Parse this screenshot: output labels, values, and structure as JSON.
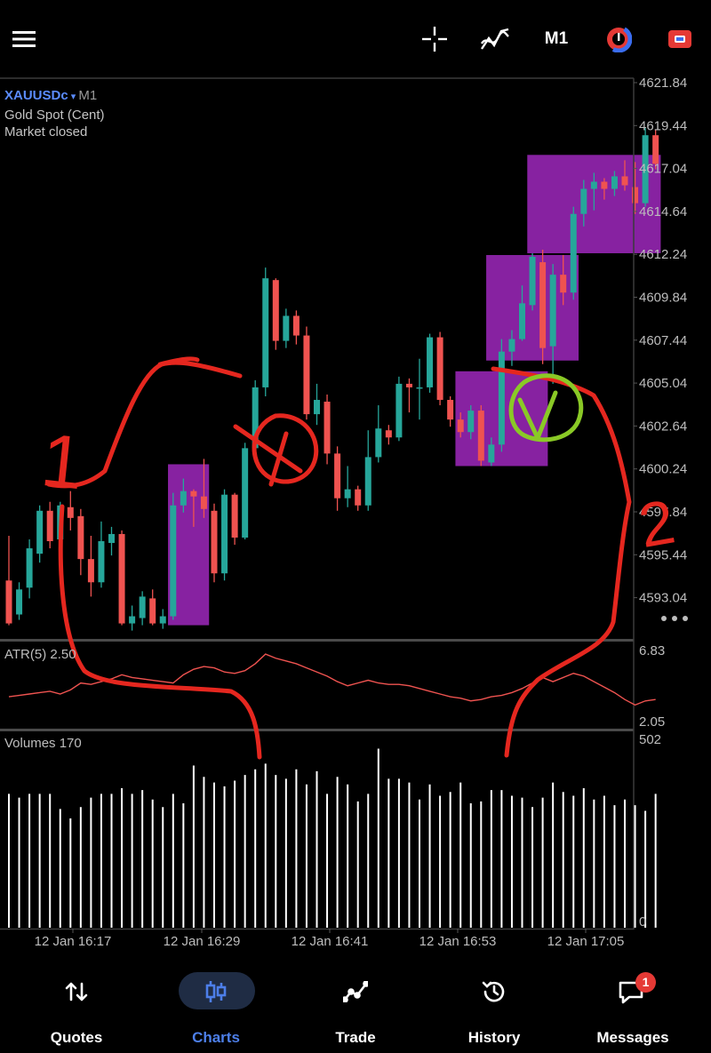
{
  "toolbar": {
    "menu_icon": "hamburger-menu-icon",
    "crosshair_icon": "crosshair-icon",
    "indicators_icon": "indicators-icon",
    "timeframe": "M1",
    "chart_type_icon": "chart-type-icon",
    "trade_icon": "trade-toggle-icon"
  },
  "chart_info": {
    "symbol": "XAUUSDc",
    "timeframe": "M1",
    "description": "Gold Spot (Cent)",
    "status": "Market closed"
  },
  "price_axis": [
    "4621.84",
    "4619.44",
    "4617.04",
    "4614.64",
    "4612.24",
    "4609.84",
    "4607.44",
    "4605.04",
    "4602.64",
    "4600.24",
    "4597.84",
    "4595.44",
    "4593.04"
  ],
  "atr": {
    "label": "ATR(5) 2.50",
    "axis_max": "6.83",
    "axis_min": "2.05"
  },
  "volumes": {
    "label": "Volumes 170",
    "axis_max": "502",
    "axis_min": "0"
  },
  "time_axis": [
    "12 Jan 16:17",
    "12 Jan 16:29",
    "12 Jan 16:41",
    "12 Jan 16:53",
    "12 Jan 17:05"
  ],
  "annotations": {
    "one": "1",
    "two": "2"
  },
  "colors": {
    "bull": "#26a69a",
    "bear": "#ef5350",
    "zone": "#8e24aa",
    "ink_red": "#e5271f",
    "ink_green": "#8ac926",
    "accent": "#4d7fe9"
  },
  "nav": {
    "items": [
      {
        "label": "Quotes",
        "icon": "quotes-arrows-icon"
      },
      {
        "label": "Charts",
        "icon": "charts-candles-icon"
      },
      {
        "label": "Trade",
        "icon": "trade-line-icon"
      },
      {
        "label": "History",
        "icon": "history-clock-icon"
      },
      {
        "label": "Messages",
        "icon": "messages-icon"
      }
    ],
    "messages_badge": "1"
  },
  "chart_data": {
    "type": "candlestick",
    "symbol": "XAUUSDc",
    "timeframe": "M1",
    "ylim": [
      4591.5,
      4622.5
    ],
    "candles_ohlc": [
      [
        4594.0,
        4596.5,
        4591.5,
        4591.6
      ],
      [
        4592.1,
        4593.9,
        4591.8,
        4593.5
      ],
      [
        4593.6,
        4596.3,
        4593.0,
        4595.8
      ],
      [
        4595.5,
        4598.2,
        4595.0,
        4597.9
      ],
      [
        4597.9,
        4598.4,
        4595.8,
        4596.2
      ],
      [
        4596.3,
        4598.4,
        4595.9,
        4598.2
      ],
      [
        4598.1,
        4599.0,
        4596.8,
        4597.5
      ],
      [
        4597.6,
        4598.0,
        4594.3,
        4595.2
      ],
      [
        4595.2,
        4596.5,
        4593.1,
        4593.9
      ],
      [
        4593.9,
        4597.3,
        4593.6,
        4596.2
      ],
      [
        4596.1,
        4597.0,
        4595.4,
        4596.6
      ],
      [
        4596.6,
        4596.8,
        4591.5,
        4591.6
      ],
      [
        4591.6,
        4592.6,
        4591.2,
        4592.0
      ],
      [
        4591.9,
        4593.4,
        4591.5,
        4593.1
      ],
      [
        4593.0,
        4593.5,
        4591.5,
        4591.6
      ],
      [
        4591.6,
        4592.4,
        4591.3,
        4592.0
      ],
      [
        4592.0,
        4598.9,
        4591.8,
        4598.2
      ],
      [
        4598.2,
        4599.7,
        4597.8,
        4599.0
      ],
      [
        4599.0,
        4599.1,
        4597.0,
        4598.7
      ],
      [
        4598.7,
        4600.8,
        4597.5,
        4598.0
      ],
      [
        4597.9,
        4598.3,
        4593.9,
        4594.4
      ],
      [
        4594.4,
        4599.1,
        4594.0,
        4598.8
      ],
      [
        4598.8,
        4598.9,
        4596.0,
        4596.4
      ],
      [
        4596.4,
        4601.7,
        4596.3,
        4601.4
      ],
      [
        4601.4,
        4605.2,
        4601.0,
        4604.8
      ],
      [
        4604.8,
        4611.5,
        4604.3,
        4610.9
      ],
      [
        4610.8,
        4610.9,
        4606.9,
        4607.4
      ],
      [
        4607.4,
        4609.2,
        4607.0,
        4608.8
      ],
      [
        4608.8,
        4609.1,
        4607.2,
        4607.7
      ],
      [
        4607.7,
        4608.2,
        4603.0,
        4603.3
      ],
      [
        4603.3,
        4605.0,
        4602.7,
        4604.1
      ],
      [
        4604.0,
        4604.4,
        4600.5,
        4601.1
      ],
      [
        4601.1,
        4601.5,
        4597.9,
        4598.6
      ],
      [
        4598.6,
        4600.4,
        4598.1,
        4599.1
      ],
      [
        4599.1,
        4599.3,
        4597.9,
        4598.2
      ],
      [
        4598.2,
        4602.4,
        4597.9,
        4600.9
      ],
      [
        4600.9,
        4603.8,
        4600.6,
        4602.5
      ],
      [
        4602.4,
        4602.7,
        4601.6,
        4602.0
      ],
      [
        4602.0,
        4605.4,
        4601.8,
        4605.0
      ],
      [
        4605.0,
        4605.3,
        4603.4,
        4604.8
      ],
      [
        4604.8,
        4606.4,
        4603.0,
        4604.8
      ],
      [
        4604.8,
        4607.8,
        4604.5,
        4607.6
      ],
      [
        4607.6,
        4607.9,
        4603.8,
        4604.1
      ],
      [
        4604.1,
        4604.3,
        4602.6,
        4603.0
      ],
      [
        4603.0,
        4603.4,
        4602.0,
        4602.3
      ],
      [
        4602.3,
        4603.8,
        4601.9,
        4603.5
      ],
      [
        4603.5,
        4603.8,
        4600.4,
        4600.7
      ],
      [
        4600.6,
        4602.0,
        4600.4,
        4601.6
      ],
      [
        4601.6,
        4607.5,
        4601.2,
        4606.8
      ],
      [
        4606.8,
        4608.0,
        4606.0,
        4607.5
      ],
      [
        4607.5,
        4610.5,
        4607.4,
        4609.5
      ],
      [
        4609.4,
        4612.3,
        4609.1,
        4612.1
      ],
      [
        4611.8,
        4612.5,
        4606.1,
        4607.0
      ],
      [
        4607.1,
        4611.7,
        4605.0,
        4611.1
      ],
      [
        4611.1,
        4612.2,
        4609.4,
        4610.1
      ],
      [
        4610.1,
        4614.9,
        4609.7,
        4614.5
      ],
      [
        4614.5,
        4616.4,
        4613.8,
        4615.9
      ],
      [
        4615.9,
        4616.8,
        4614.7,
        4616.3
      ],
      [
        4616.3,
        4616.5,
        4615.3,
        4615.9
      ],
      [
        4615.9,
        4616.9,
        4615.5,
        4616.6
      ],
      [
        4616.6,
        4617.5,
        4615.8,
        4616.1
      ],
      [
        4616.0,
        4617.4,
        4614.5,
        4615.1
      ],
      [
        4615.1,
        4619.3,
        4614.9,
        4618.9
      ],
      [
        4618.9,
        4619.2,
        4617.0,
        4617.3
      ]
    ],
    "zones": [
      {
        "from_bar": 16,
        "to_bar": 19,
        "low": 4591.5,
        "high": 4600.5
      },
      {
        "from_bar": 44,
        "to_bar": 52,
        "low": 4600.4,
        "high": 4605.7
      },
      {
        "from_bar": 47,
        "to_bar": 55,
        "low": 4606.3,
        "high": 4612.2
      },
      {
        "from_bar": 51,
        "to_bar": 63,
        "low": 4612.3,
        "high": 4617.8
      }
    ],
    "atr_values": [
      3.4,
      3.5,
      3.6,
      3.7,
      3.8,
      3.6,
      3.9,
      4.4,
      4.3,
      4.5,
      4.7,
      5.0,
      4.8,
      4.7,
      4.6,
      4.5,
      4.4,
      5.0,
      5.4,
      5.6,
      5.5,
      5.2,
      5.1,
      5.3,
      5.8,
      6.5,
      6.2,
      6.0,
      5.8,
      5.5,
      5.2,
      4.9,
      4.5,
      4.2,
      4.4,
      4.6,
      4.4,
      4.3,
      4.3,
      4.2,
      4.0,
      3.8,
      3.6,
      3.4,
      3.3,
      3.1,
      3.2,
      3.4,
      3.5,
      3.7,
      4.0,
      4.4,
      4.8,
      4.5,
      4.8,
      5.1,
      4.9,
      4.5,
      4.1,
      3.7,
      3.2,
      2.8,
      3.1,
      3.2
    ],
    "atr_ylim": [
      2.05,
      6.83
    ],
    "volumes": [
      355,
      345,
      355,
      355,
      355,
      315,
      290,
      320,
      345,
      355,
      355,
      370,
      355,
      365,
      340,
      320,
      355,
      330,
      430,
      400,
      385,
      375,
      390,
      405,
      420,
      435,
      405,
      395,
      420,
      380,
      415,
      355,
      400,
      380,
      335,
      355,
      475,
      395,
      395,
      385,
      340,
      380,
      350,
      360,
      385,
      330,
      335,
      365,
      365,
      350,
      345,
      320,
      345,
      385,
      360,
      350,
      370,
      340,
      350,
      325,
      340,
      325,
      310,
      355
    ],
    "volume_ylim": [
      0,
      502
    ]
  }
}
